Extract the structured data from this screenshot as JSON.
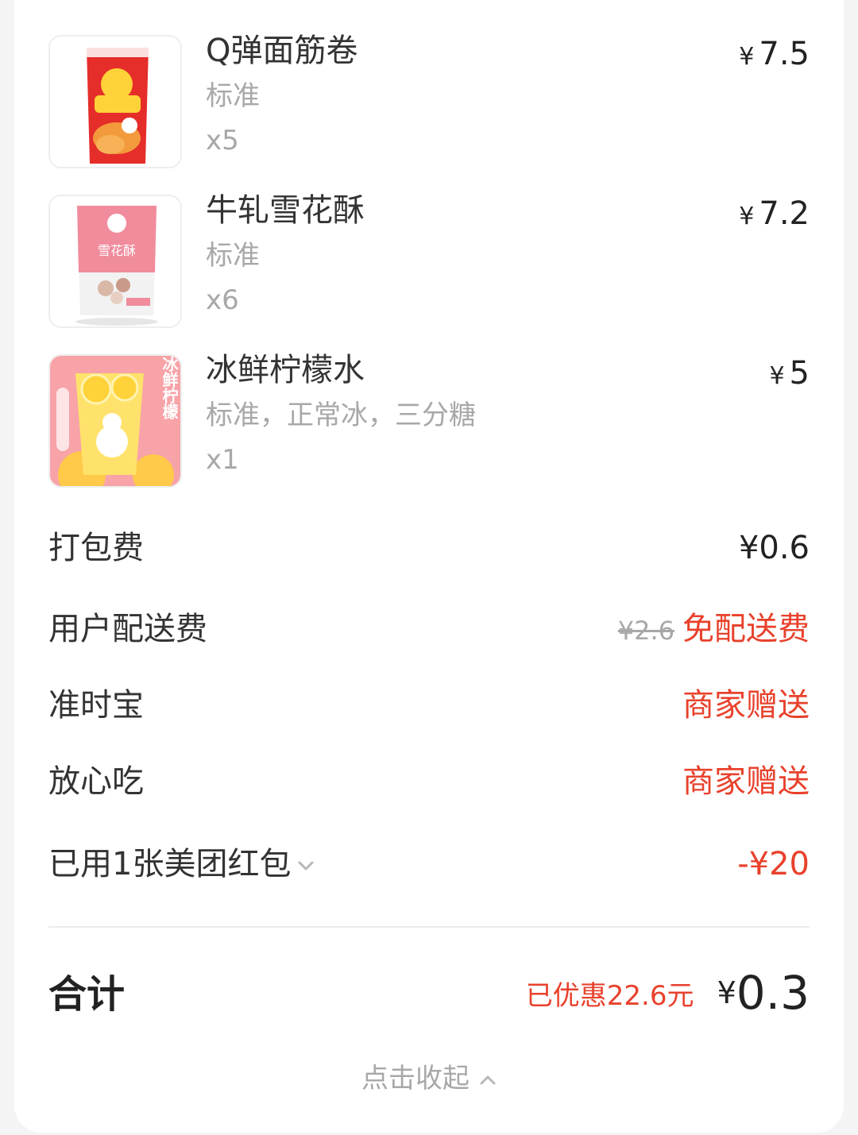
{
  "items": [
    {
      "name": "Q弹面筋卷",
      "spec": "标准",
      "qty": "x5",
      "currency": "¥",
      "price": "7.5",
      "image": "package-red-snack"
    },
    {
      "name": "牛轧雪花酥",
      "spec": "标准",
      "qty": "x6",
      "currency": "¥",
      "price": "7.2",
      "image": "package-pink-snack",
      "package_text": "雪花酥"
    },
    {
      "name": "冰鲜柠檬水",
      "spec": "标准，正常冰，三分糖",
      "qty": "x1",
      "currency": "¥",
      "price": "5",
      "image": "lemon-drink",
      "package_text": "冰鲜柠檬"
    }
  ],
  "fees": {
    "packing": {
      "label": "打包费",
      "value": "¥0.6"
    },
    "delivery": {
      "label": "用户配送费",
      "original": "¥2.6",
      "value": "免配送费"
    },
    "ontime": {
      "label": "准时宝",
      "value": "商家赠送"
    },
    "assurance": {
      "label": "放心吃",
      "value": "商家赠送"
    },
    "redpacket": {
      "label": "已用1张美团红包",
      "value": "-¥20"
    }
  },
  "total": {
    "label": "合计",
    "saved": "已优惠22.6元",
    "currency": "¥",
    "amount": "0.3"
  },
  "collapse_label": "点击收起",
  "colors": {
    "accent": "#e8412c",
    "muted": "#a8a8a8",
    "text": "#333333"
  }
}
